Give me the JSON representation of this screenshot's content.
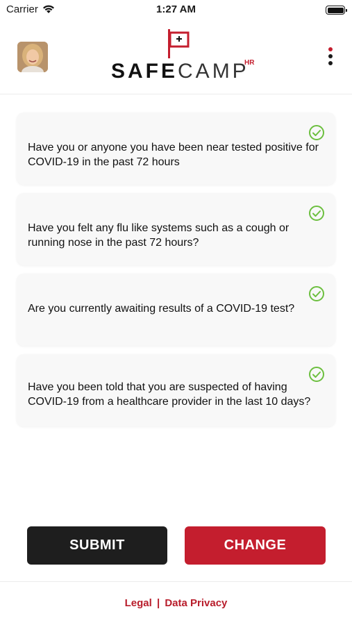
{
  "status_bar": {
    "carrier": "Carrier",
    "time": "1:27 AM"
  },
  "header": {
    "logo_safe": "SAFE",
    "logo_camp": "CAMP",
    "logo_hr": "HR",
    "brand_color": "#c41e2e"
  },
  "questions": [
    {
      "text": "Have you or anyone you have been near tested positive for COVID-19 in the past 72 hours",
      "checked": true
    },
    {
      "text": "Have you felt any flu like systems such as a cough or running nose in the past 72 hours?",
      "checked": true
    },
    {
      "text": "Are you currently awaiting results of a COVID-19 test?",
      "checked": true
    },
    {
      "text": "Have you been told that you are suspected of having COVID-19 from a healthcare provider in the last 10 days?",
      "checked": true
    }
  ],
  "actions": {
    "submit_label": "SUBMIT",
    "change_label": "CHANGE"
  },
  "footer": {
    "legal_label": "Legal",
    "separator": "|",
    "privacy_label": "Data Privacy"
  },
  "colors": {
    "accent_red": "#c41e2e",
    "check_green": "#6cbf3f",
    "submit_dark": "#1e1e1e"
  }
}
